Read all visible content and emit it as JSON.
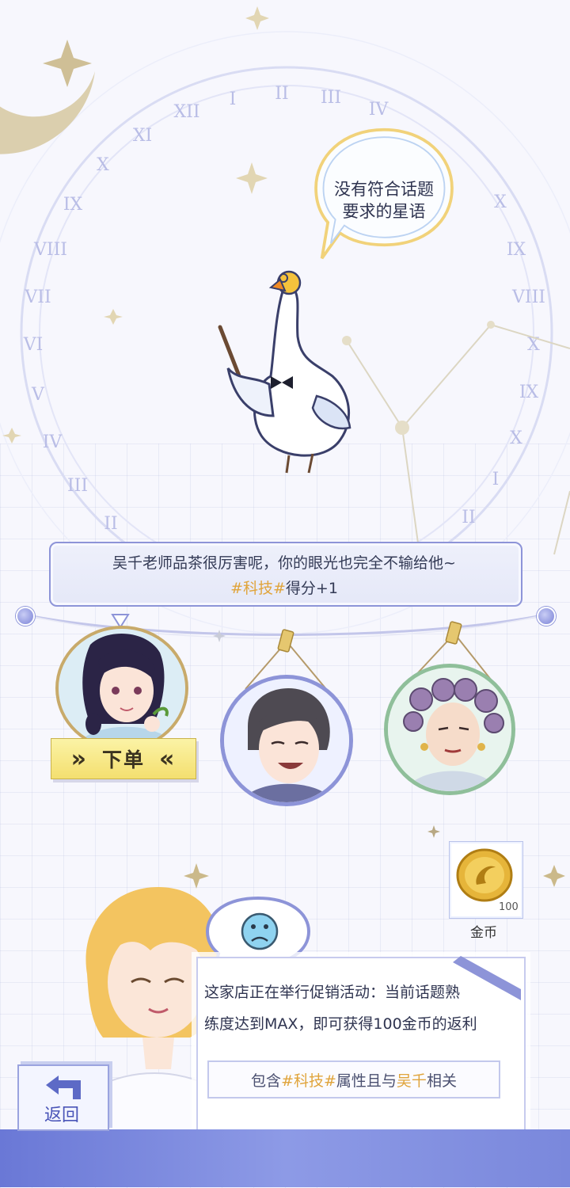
{
  "goose_bubble": {
    "line1": "没有符合话题",
    "line2": "要求的星语"
  },
  "dialog": {
    "line1": "吴千老师品茶很厉害呢，你的眼光也完全不输给他~",
    "tag": "#科技#",
    "score": "得分+1"
  },
  "portraits": [
    {
      "name": "portrait-woman-braid",
      "selected": true
    },
    {
      "name": "portrait-man-laughing",
      "selected": false
    },
    {
      "name": "portrait-woman-curlers",
      "selected": false
    }
  ],
  "order_button": {
    "label": "下单",
    "left_arrows": "»",
    "right_arrows": "«"
  },
  "reward": {
    "count": "100",
    "label": "金币"
  },
  "info": {
    "text_line1": "这家店正在举行促销活动：当前话题熟",
    "text_line2": "练度达到MAX，即可获得100金币的返利",
    "cond_prefix": "包含",
    "cond_tag": "#科技#",
    "cond_mid": "属性且与",
    "cond_name": "吴千",
    "cond_suffix": "相关"
  },
  "back_button": {
    "label": "返回"
  },
  "colors": {
    "accent": "#8d94d8",
    "tag": "#e0a43b",
    "button_yellow": "#f4df6f"
  },
  "icons": [
    "moon-icon",
    "sad-face-icon",
    "back-arrow-icon",
    "coin-icon",
    "double-chevron-right-icon",
    "double-chevron-left-icon"
  ]
}
